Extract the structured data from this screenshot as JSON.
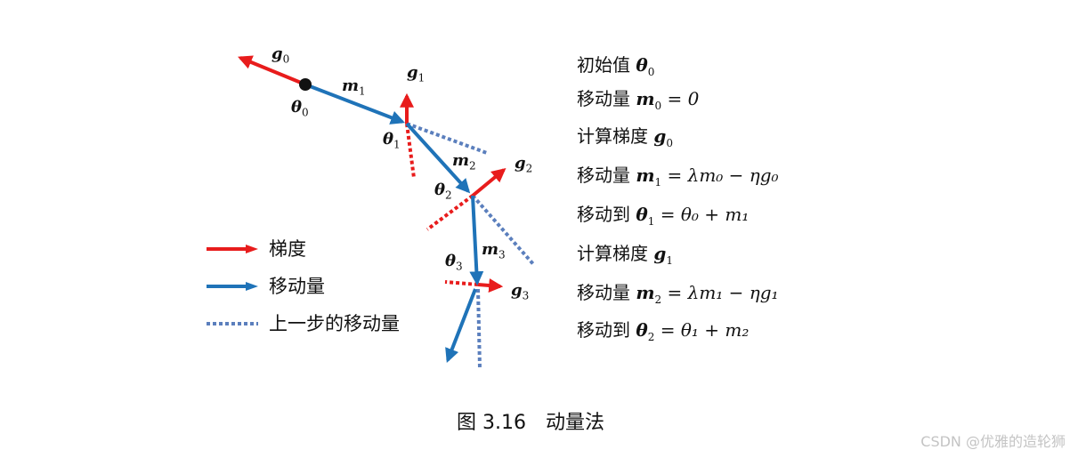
{
  "labels": {
    "g0": "g",
    "g0_sub": "0",
    "theta0": "θ",
    "theta0_sub": "0",
    "m1": "m",
    "m1_sub": "1",
    "g1": "g",
    "g1_sub": "1",
    "theta1": "θ",
    "theta1_sub": "1",
    "m2": "m",
    "m2_sub": "2",
    "g2": "g",
    "g2_sub": "2",
    "theta2": "θ",
    "theta2_sub": "2",
    "m3": "m",
    "m3_sub": "3",
    "theta3": "θ",
    "theta3_sub": "3",
    "g3": "g",
    "g3_sub": "3"
  },
  "legend": [
    {
      "text": "梯度",
      "style": "red-arrow"
    },
    {
      "text": "移动量",
      "style": "blue-arrow"
    },
    {
      "text": "上一步的移动量",
      "style": "dotted-line"
    }
  ],
  "steps": [
    {
      "text": "初始值",
      "math": "θ",
      "sub": "0",
      "rest": ""
    },
    {
      "text": "移动量",
      "math": "m",
      "sub": "0",
      "rest": " = 0"
    },
    {
      "text": "计算梯度",
      "math": "g",
      "sub": "0",
      "rest": ""
    },
    {
      "text": "移动量",
      "math": "m",
      "sub": "1",
      "rest": " = λm₀ − ηg₀"
    },
    {
      "text": "移动到",
      "math": "θ",
      "sub": "1",
      "rest": " = θ₀ + m₁"
    },
    {
      "text": "计算梯度",
      "math": "g",
      "sub": "1",
      "rest": ""
    },
    {
      "text": "移动量",
      "math": "m",
      "sub": "2",
      "rest": " = λm₁ − ηg₁"
    },
    {
      "text": "移动到",
      "math": "θ",
      "sub": "2",
      "rest": " = θ₁ + m₂"
    }
  ],
  "caption": {
    "figure": "图 3.16",
    "title": "动量法"
  },
  "watermark": "CSDN @优雅的造轮狮",
  "colors": {
    "gradient": "#e81c1c",
    "move": "#1f73b8",
    "prev_move": "#5b7fbd"
  }
}
